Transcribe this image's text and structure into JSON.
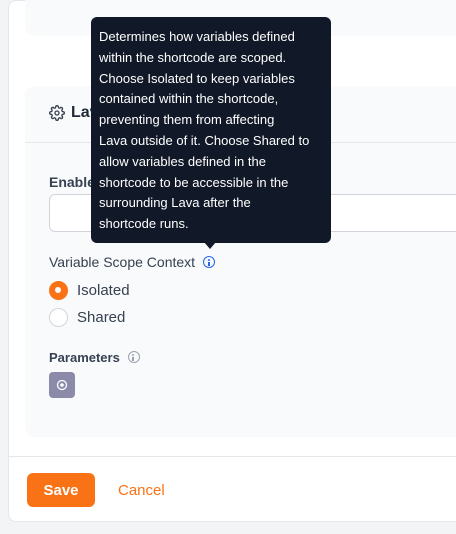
{
  "section": {
    "title": "Lava",
    "enabled_label": "Enabled Lava Commands"
  },
  "variable_scope": {
    "label": "Variable Scope Context",
    "options": [
      {
        "label": "Isolated",
        "checked": true
      },
      {
        "label": "Shared",
        "checked": false
      }
    ]
  },
  "parameters": {
    "label": "Parameters"
  },
  "footer": {
    "save_label": "Save",
    "cancel_label": "Cancel"
  },
  "tooltip": {
    "text": "Determines how variables defined\nwithin the shortcode are scoped.\nChoose Isolated to keep variables\ncontained within the shortcode,\npreventing them from affecting\nLava outside of it. Choose Shared to\nallow variables defined in the\nshortcode to be accessible in the\nsurrounding Lava after the\nshortcode runs."
  },
  "colors": {
    "accent": "#f97316",
    "tooltip_bg": "#111827",
    "info_icon": "#2563eb"
  }
}
